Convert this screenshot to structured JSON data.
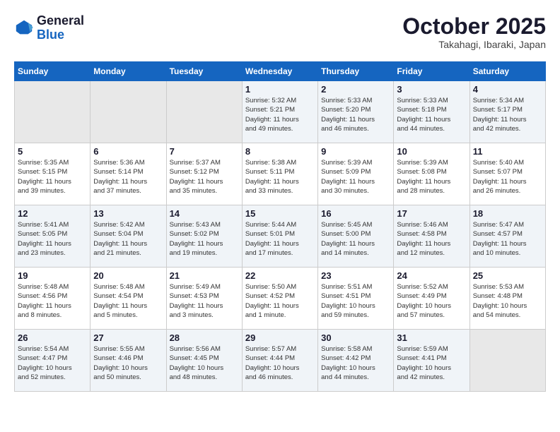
{
  "header": {
    "logo_general": "General",
    "logo_blue": "Blue",
    "month": "October 2025",
    "location": "Takahagi, Ibaraki, Japan"
  },
  "weekdays": [
    "Sunday",
    "Monday",
    "Tuesday",
    "Wednesday",
    "Thursday",
    "Friday",
    "Saturday"
  ],
  "weeks": [
    [
      {
        "day": "",
        "info": ""
      },
      {
        "day": "",
        "info": ""
      },
      {
        "day": "",
        "info": ""
      },
      {
        "day": "1",
        "info": "Sunrise: 5:32 AM\nSunset: 5:21 PM\nDaylight: 11 hours\nand 49 minutes."
      },
      {
        "day": "2",
        "info": "Sunrise: 5:33 AM\nSunset: 5:20 PM\nDaylight: 11 hours\nand 46 minutes."
      },
      {
        "day": "3",
        "info": "Sunrise: 5:33 AM\nSunset: 5:18 PM\nDaylight: 11 hours\nand 44 minutes."
      },
      {
        "day": "4",
        "info": "Sunrise: 5:34 AM\nSunset: 5:17 PM\nDaylight: 11 hours\nand 42 minutes."
      }
    ],
    [
      {
        "day": "5",
        "info": "Sunrise: 5:35 AM\nSunset: 5:15 PM\nDaylight: 11 hours\nand 39 minutes."
      },
      {
        "day": "6",
        "info": "Sunrise: 5:36 AM\nSunset: 5:14 PM\nDaylight: 11 hours\nand 37 minutes."
      },
      {
        "day": "7",
        "info": "Sunrise: 5:37 AM\nSunset: 5:12 PM\nDaylight: 11 hours\nand 35 minutes."
      },
      {
        "day": "8",
        "info": "Sunrise: 5:38 AM\nSunset: 5:11 PM\nDaylight: 11 hours\nand 33 minutes."
      },
      {
        "day": "9",
        "info": "Sunrise: 5:39 AM\nSunset: 5:09 PM\nDaylight: 11 hours\nand 30 minutes."
      },
      {
        "day": "10",
        "info": "Sunrise: 5:39 AM\nSunset: 5:08 PM\nDaylight: 11 hours\nand 28 minutes."
      },
      {
        "day": "11",
        "info": "Sunrise: 5:40 AM\nSunset: 5:07 PM\nDaylight: 11 hours\nand 26 minutes."
      }
    ],
    [
      {
        "day": "12",
        "info": "Sunrise: 5:41 AM\nSunset: 5:05 PM\nDaylight: 11 hours\nand 23 minutes."
      },
      {
        "day": "13",
        "info": "Sunrise: 5:42 AM\nSunset: 5:04 PM\nDaylight: 11 hours\nand 21 minutes."
      },
      {
        "day": "14",
        "info": "Sunrise: 5:43 AM\nSunset: 5:02 PM\nDaylight: 11 hours\nand 19 minutes."
      },
      {
        "day": "15",
        "info": "Sunrise: 5:44 AM\nSunset: 5:01 PM\nDaylight: 11 hours\nand 17 minutes."
      },
      {
        "day": "16",
        "info": "Sunrise: 5:45 AM\nSunset: 5:00 PM\nDaylight: 11 hours\nand 14 minutes."
      },
      {
        "day": "17",
        "info": "Sunrise: 5:46 AM\nSunset: 4:58 PM\nDaylight: 11 hours\nand 12 minutes."
      },
      {
        "day": "18",
        "info": "Sunrise: 5:47 AM\nSunset: 4:57 PM\nDaylight: 11 hours\nand 10 minutes."
      }
    ],
    [
      {
        "day": "19",
        "info": "Sunrise: 5:48 AM\nSunset: 4:56 PM\nDaylight: 11 hours\nand 8 minutes."
      },
      {
        "day": "20",
        "info": "Sunrise: 5:48 AM\nSunset: 4:54 PM\nDaylight: 11 hours\nand 5 minutes."
      },
      {
        "day": "21",
        "info": "Sunrise: 5:49 AM\nSunset: 4:53 PM\nDaylight: 11 hours\nand 3 minutes."
      },
      {
        "day": "22",
        "info": "Sunrise: 5:50 AM\nSunset: 4:52 PM\nDaylight: 11 hours\nand 1 minute."
      },
      {
        "day": "23",
        "info": "Sunrise: 5:51 AM\nSunset: 4:51 PM\nDaylight: 10 hours\nand 59 minutes."
      },
      {
        "day": "24",
        "info": "Sunrise: 5:52 AM\nSunset: 4:49 PM\nDaylight: 10 hours\nand 57 minutes."
      },
      {
        "day": "25",
        "info": "Sunrise: 5:53 AM\nSunset: 4:48 PM\nDaylight: 10 hours\nand 54 minutes."
      }
    ],
    [
      {
        "day": "26",
        "info": "Sunrise: 5:54 AM\nSunset: 4:47 PM\nDaylight: 10 hours\nand 52 minutes."
      },
      {
        "day": "27",
        "info": "Sunrise: 5:55 AM\nSunset: 4:46 PM\nDaylight: 10 hours\nand 50 minutes."
      },
      {
        "day": "28",
        "info": "Sunrise: 5:56 AM\nSunset: 4:45 PM\nDaylight: 10 hours\nand 48 minutes."
      },
      {
        "day": "29",
        "info": "Sunrise: 5:57 AM\nSunset: 4:44 PM\nDaylight: 10 hours\nand 46 minutes."
      },
      {
        "day": "30",
        "info": "Sunrise: 5:58 AM\nSunset: 4:42 PM\nDaylight: 10 hours\nand 44 minutes."
      },
      {
        "day": "31",
        "info": "Sunrise: 5:59 AM\nSunset: 4:41 PM\nDaylight: 10 hours\nand 42 minutes."
      },
      {
        "day": "",
        "info": ""
      }
    ]
  ]
}
